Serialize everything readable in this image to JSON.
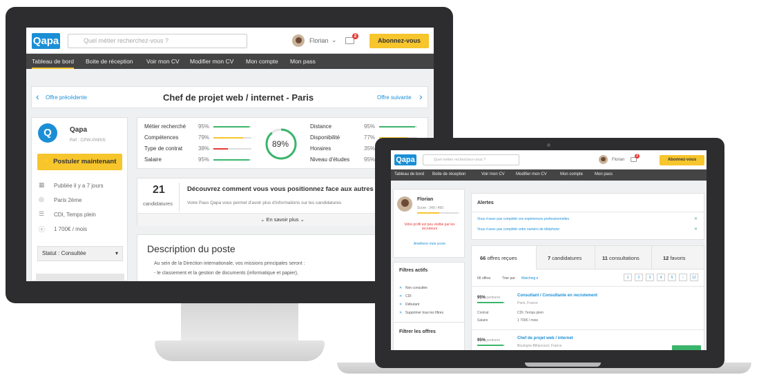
{
  "desktop": {
    "logo": "Qapa",
    "search_placeholder": "Quel métier recherchez-vous ?",
    "user_name": "Florian",
    "notif_count": "2",
    "subscribe_label": "Abonnez-vous",
    "nav": [
      "Tableau de bord",
      "Boite de réception",
      "Voir mon CV",
      "Modifier mon CV",
      "Mon compte",
      "Mon pass"
    ],
    "prev_offer": "Offre précédente",
    "next_offer": "Offre suivante",
    "job_title": "Chef de projet web / internet - Paris",
    "company": {
      "logo_letter": "Q",
      "name": "Qapa",
      "ref": "Réf : CPW-PARIS",
      "apply_label": "Postuler maintenant",
      "details": [
        "Publiée il y a 7 jours",
        "Paris 2ème",
        "CDI, Temps plein",
        "1 700€ / mois"
      ],
      "status": "Statut : Consultée"
    },
    "match_left": [
      {
        "label": "Métier recherché",
        "pct": "95%",
        "value": 0.95,
        "color": "#3bb56b"
      },
      {
        "label": "Compétences",
        "pct": "79%",
        "value": 0.79,
        "color": "#f7c52c"
      },
      {
        "label": "Type de contrat",
        "pct": "38%",
        "value": 0.38,
        "color": "#e53935"
      },
      {
        "label": "Salaire",
        "pct": "95%",
        "value": 0.95,
        "color": "#3bb56b"
      }
    ],
    "match_right": [
      {
        "label": "Distance",
        "pct": "95%",
        "value": 0.95,
        "color": "#3bb56b"
      },
      {
        "label": "Disponibilité",
        "pct": "77%",
        "value": 0.77,
        "color": "#f7c52c"
      },
      {
        "label": "Horaires",
        "pct": "35%",
        "value": 0.35,
        "color": "#e53935"
      },
      {
        "label": "Niveau d'études",
        "pct": "95%",
        "value": 0.95,
        "color": "#3bb56b"
      }
    ],
    "match_total": "89%",
    "match_total_value": 0.89,
    "candidatures_count": "21",
    "candidatures_label": "candidatures",
    "position_title": "Découvrez comment vous vous positionnez face aux autres",
    "position_text": "Votre Pass Qapa vous permet d'avoir plus d'informations sur les candidatures",
    "learn_more": "En savoir plus",
    "description_title": "Description du poste",
    "description_lines": [
      "Au sein de la Direction internationale, vos missions principales seront :",
      "- le classement et la gestion de documents (informatique et papier),"
    ]
  },
  "laptop": {
    "logo": "Qapa",
    "search_placeholder": "Quel métier recherchez-vous ?",
    "user_name": "Florian",
    "notif_count": "2",
    "subscribe_label": "Abonnez-vous",
    "nav": [
      "Tableau de bord",
      "Boite de réception",
      "Voir mon CV",
      "Modifier mon CV",
      "Mon compte",
      "Mon pass"
    ],
    "profile": {
      "name": "Florian",
      "score": "Score : 240 / 450",
      "score_value": 0.53,
      "warning": "Votre profil est peu visible par les recruteurs",
      "improve": "Améliorer mon score"
    },
    "filters_title": "Filtres actifs",
    "filters": [
      "Non consultée",
      "CDI",
      "Débutant",
      "Supprimer tous les filtres"
    ],
    "filter_offers": "Filtrer les offres",
    "alerts_title": "Alertes",
    "alerts": [
      "Vous n'avez pas complété vos expériences professionnelles",
      "Vous n'avez pas complété votre numéro de téléphone"
    ],
    "tabs": [
      {
        "count": "66",
        "label": "offres reçues"
      },
      {
        "count": "7",
        "label": "candidatures"
      },
      {
        "count": "11",
        "label": "consultations"
      },
      {
        "count": "12",
        "label": "favoris"
      }
    ],
    "offers_count": "66 offres",
    "sort_label": "Trier par :",
    "sort_value": "Matching",
    "pages": [
      "1",
      "2",
      "3",
      "4",
      "5",
      "›",
      "12"
    ],
    "offers": [
      {
        "pct": "95%",
        "pct_label": "pertinent",
        "title": "Consultant / Consultante en recrutement",
        "location": "Paris, France",
        "contract_label": "Contrat",
        "contract": "CDI, Temps plein",
        "salary_label": "Salaire",
        "salary": "1 700€ / mois"
      },
      {
        "pct": "95%",
        "pct_label": "pertinent",
        "title": "Chef de projet web / internet",
        "location": "Boulogne-Billancourt, France"
      }
    ]
  }
}
